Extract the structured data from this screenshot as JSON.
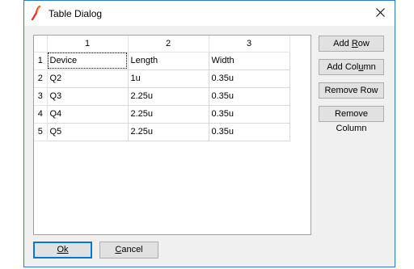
{
  "window": {
    "title": "Table Dialog",
    "app_icon": "ltspice-icon",
    "close_icon": "close-icon"
  },
  "table": {
    "column_headers": [
      "1",
      "2",
      "3"
    ],
    "rows": [
      {
        "index": "1",
        "cells": [
          "Device",
          "Length",
          "Width"
        ]
      },
      {
        "index": "2",
        "cells": [
          "Q2",
          "1u",
          "0.35u"
        ]
      },
      {
        "index": "3",
        "cells": [
          "Q3",
          "2.25u",
          "0.35u"
        ]
      },
      {
        "index": "4",
        "cells": [
          "Q4",
          "2.25u",
          "0.35u"
        ]
      },
      {
        "index": "5",
        "cells": [
          "Q5",
          "2.25u",
          "0.35u"
        ]
      }
    ]
  },
  "side_buttons": {
    "add_row": {
      "pre": "Add ",
      "key": "R",
      "post": "ow"
    },
    "add_column": {
      "pre": "Add Col",
      "key": "u",
      "post": "mn"
    },
    "remove_row": "Remove Row",
    "remove_column": "Remove Column"
  },
  "bottom_buttons": {
    "ok": "Ok",
    "cancel": {
      "key": "C",
      "post": "ancel"
    }
  },
  "colors": {
    "accent": "#0078d7",
    "icon_red": "#e8312f",
    "icon_orange": "#f5a20f"
  }
}
